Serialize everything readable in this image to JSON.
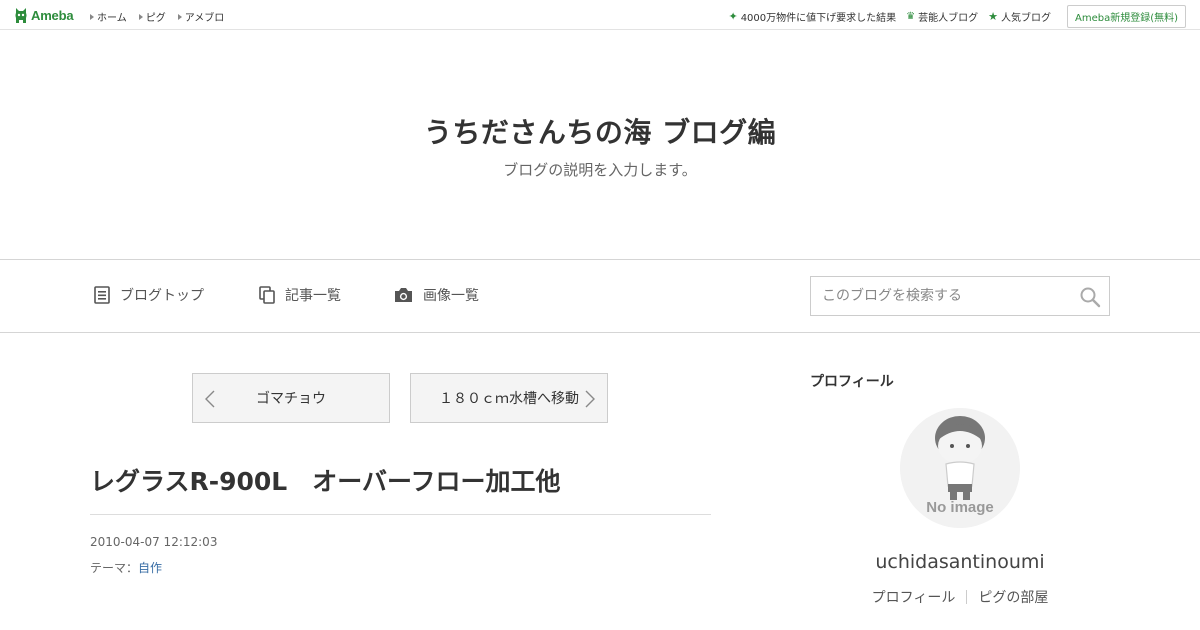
{
  "topbar": {
    "logo_text": "Ameba",
    "nav": [
      "ホーム",
      "ピグ",
      "アメブロ"
    ],
    "right_links": [
      {
        "label": "4000万物件に値下げ要求した結果",
        "icon": "sparkle-icon"
      },
      {
        "label": "芸能人ブログ",
        "icon": "crown-icon"
      },
      {
        "label": "人気ブログ",
        "icon": "star-icon"
      }
    ],
    "register_label": "Ameba新規登録(無料)"
  },
  "header": {
    "title": "うちださんちの海 ブログ編",
    "description": "ブログの説明を入力します。"
  },
  "navbar": {
    "items": [
      {
        "label": "ブログトップ",
        "icon": "document-icon"
      },
      {
        "label": "記事一覧",
        "icon": "copy-icon"
      },
      {
        "label": "画像一覧",
        "icon": "camera-icon"
      }
    ],
    "search_placeholder": "このブログを検索する"
  },
  "article": {
    "prev_label": "ゴマチョウ",
    "next_label": "１８０ｃｍ水槽へ移動",
    "title": "レグラスR-900L　オーバーフロー加工他",
    "date": "2010-04-07 12:12:03",
    "theme_prefix": "テーマ：",
    "theme": "自作"
  },
  "sidebar": {
    "heading": "プロフィール",
    "avatar_text": "No image",
    "username": "uchidasantinoumi",
    "links": [
      "プロフィール",
      "ピグの部屋"
    ]
  },
  "colors": {
    "brand_green": "#2d8c3c",
    "link_blue": "#3a6ea5"
  }
}
